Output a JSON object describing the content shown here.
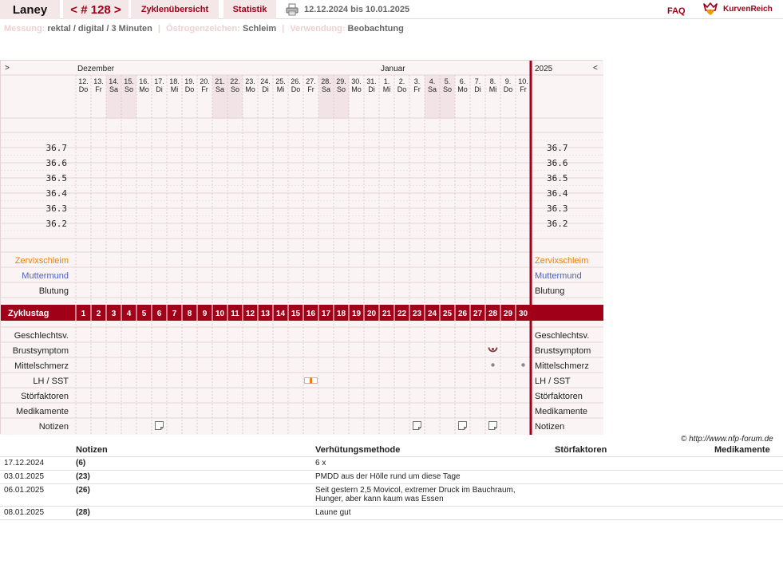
{
  "topbar": {
    "user_name": "Laney",
    "cycle_label": "< # 128 >",
    "overview_tab": "Zyklenübersicht",
    "stats_tab": "Statistik",
    "print_icon": "printer-icon",
    "date_range": "12.12.2024 bis 10.01.2025",
    "faq": "FAQ",
    "logo_icon": "crown-heart-icon",
    "logo_text": "KurvenReich"
  },
  "info": {
    "measure_label": "Messung:",
    "measure_value": "rektal / digital / 3 Minuten",
    "estrogen_label": "Östrogenzeichen:",
    "estrogen_value": "Schleim",
    "usage_label": "Verwendung:",
    "usage_value": "Beobachtung",
    "separator": "|"
  },
  "chart": {
    "nav_left": ">",
    "nav_right": "<",
    "months": [
      {
        "label": "Dezember",
        "start_index": 0
      },
      {
        "label": "Januar",
        "start_index": 20
      }
    ],
    "year_label": "2025",
    "days": [
      {
        "d": "12.",
        "w": "Do",
        "we": false
      },
      {
        "d": "13.",
        "w": "Fr",
        "we": false
      },
      {
        "d": "14.",
        "w": "Sa",
        "we": true
      },
      {
        "d": "15.",
        "w": "So",
        "we": true
      },
      {
        "d": "16.",
        "w": "Mo",
        "we": false
      },
      {
        "d": "17.",
        "w": "Di",
        "we": false
      },
      {
        "d": "18.",
        "w": "Mi",
        "we": false
      },
      {
        "d": "19.",
        "w": "Do",
        "we": false
      },
      {
        "d": "20.",
        "w": "Fr",
        "we": false
      },
      {
        "d": "21.",
        "w": "Sa",
        "we": true
      },
      {
        "d": "22.",
        "w": "So",
        "we": true
      },
      {
        "d": "23.",
        "w": "Mo",
        "we": false
      },
      {
        "d": "24.",
        "w": "Di",
        "we": false
      },
      {
        "d": "25.",
        "w": "Mi",
        "we": false
      },
      {
        "d": "26.",
        "w": "Do",
        "we": false
      },
      {
        "d": "27.",
        "w": "Fr",
        "we": false
      },
      {
        "d": "28.",
        "w": "Sa",
        "we": true
      },
      {
        "d": "29.",
        "w": "So",
        "we": true
      },
      {
        "d": "30.",
        "w": "Mo",
        "we": false
      },
      {
        "d": "31.",
        "w": "Di",
        "we": false
      },
      {
        "d": "1.",
        "w": "Mi",
        "we": false
      },
      {
        "d": "2.",
        "w": "Do",
        "we": false
      },
      {
        "d": "3.",
        "w": "Fr",
        "we": false
      },
      {
        "d": "4.",
        "w": "Sa",
        "we": true
      },
      {
        "d": "5.",
        "w": "So",
        "we": true
      },
      {
        "d": "6.",
        "w": "Mo",
        "we": false
      },
      {
        "d": "7.",
        "w": "Di",
        "we": false
      },
      {
        "d": "8.",
        "w": "Mi",
        "we": false
      },
      {
        "d": "9.",
        "w": "Do",
        "we": false
      },
      {
        "d": "10.",
        "w": "Fr",
        "we": false
      }
    ],
    "temp_labels": [
      "36.7",
      "36.6",
      "36.5",
      "36.4",
      "36.3",
      "36.2"
    ],
    "rows_upper": [
      {
        "label": "Zervixschleim",
        "color": "#e8820c"
      },
      {
        "label": "Muttermund",
        "color": "#4a5fc0"
      },
      {
        "label": "Blutung",
        "color": "#222222"
      }
    ],
    "cycle_day_label": "Zyklustag",
    "cycle_days": [
      "1",
      "2",
      "3",
      "4",
      "5",
      "6",
      "7",
      "8",
      "9",
      "10",
      "11",
      "12",
      "13",
      "14",
      "15",
      "16",
      "17",
      "18",
      "19",
      "20",
      "21",
      "22",
      "23",
      "24",
      "25",
      "26",
      "27",
      "28",
      "29",
      "30"
    ],
    "rows_lower": [
      {
        "label": "Geschlechtsv."
      },
      {
        "label": "Brustsymptom"
      },
      {
        "label": "Mittelschmerz"
      },
      {
        "label": "LH / SST"
      },
      {
        "label": "Störfaktoren"
      },
      {
        "label": "Medikamente"
      },
      {
        "label": "Notizen"
      }
    ],
    "symbols": [
      {
        "row": "Brustsymptom",
        "day": 28,
        "icon": "breast-symptom-icon"
      },
      {
        "row": "Mittelschmerz",
        "day": 28,
        "icon": "dot-icon"
      },
      {
        "row": "Mittelschmerz",
        "day": 30,
        "icon": "dot-icon"
      },
      {
        "row": "LH / SST",
        "day": 16,
        "icon": "lh-test-icon"
      },
      {
        "row": "Notizen",
        "day": 6,
        "icon": "note-icon"
      },
      {
        "row": "Notizen",
        "day": 23,
        "icon": "note-icon"
      },
      {
        "row": "Notizen",
        "day": 26,
        "icon": "note-icon"
      },
      {
        "row": "Notizen",
        "day": 28,
        "icon": "note-icon"
      }
    ],
    "colors": {
      "accent": "#a00018",
      "weekend": "#f2e4e6",
      "panel": "#faf4f4"
    }
  },
  "copyright": "© http://www.nfp-forum.de",
  "notes_table": {
    "headers": [
      "Notizen",
      "Verhütungsmethode",
      "Störfaktoren",
      "Medikamente"
    ],
    "rows": [
      {
        "date": "17.12.2024",
        "day": "(6)",
        "note": "6 x"
      },
      {
        "date": "03.01.2025",
        "day": "(23)",
        "note": "PMDD aus der Hölle rund um diese Tage"
      },
      {
        "date": "06.01.2025",
        "day": "(26)",
        "note": "Seit gestern 2,5 Movicol, extremer Druck im Bauchraum,\nHunger, aber kann kaum was Essen"
      },
      {
        "date": "08.01.2025",
        "day": "(28)",
        "note": "Laune gut"
      }
    ]
  }
}
